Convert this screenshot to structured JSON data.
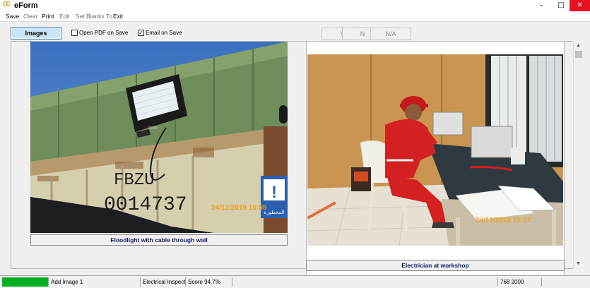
{
  "window": {
    "app_icon": "CC",
    "title": "eForm",
    "controls": [
      "–",
      "□",
      "✕"
    ]
  },
  "menu": {
    "items": [
      {
        "label": "Save",
        "enabled": true
      },
      {
        "label": "Clear",
        "enabled": false
      },
      {
        "label": "Print",
        "enabled": true
      },
      {
        "label": "Edit",
        "enabled": false
      },
      {
        "label": "Set Blanks To",
        "enabled": false
      },
      {
        "label": "Exit",
        "enabled": true
      }
    ]
  },
  "toolbar": {
    "images_label": "Images",
    "open_pdf_label": "Open PDF on Save",
    "open_pdf_checked": false,
    "email_label": "Email on Save",
    "email_checked": true,
    "answer_buttons": [
      "Y",
      "N",
      "N/A"
    ]
  },
  "images": [
    {
      "caption": "Floodlight with cable through wall",
      "stamp": "24/12/2019 16:55",
      "container_text_1": "FBZU",
      "container_text_2": "0014737",
      "sign_text": "المخطورة",
      "lamp_brand": "IONIX"
    },
    {
      "caption": "Electrician at workshop",
      "stamp": "24/12/2019 15:57"
    }
  ],
  "statusbar": {
    "action": "Add Image 1",
    "category": "Electrical Inspect",
    "score": "Score 94.7%",
    "resolution": "768 2000",
    "progress_percent": 100,
    "colors": {
      "progress": "#06b025"
    }
  }
}
